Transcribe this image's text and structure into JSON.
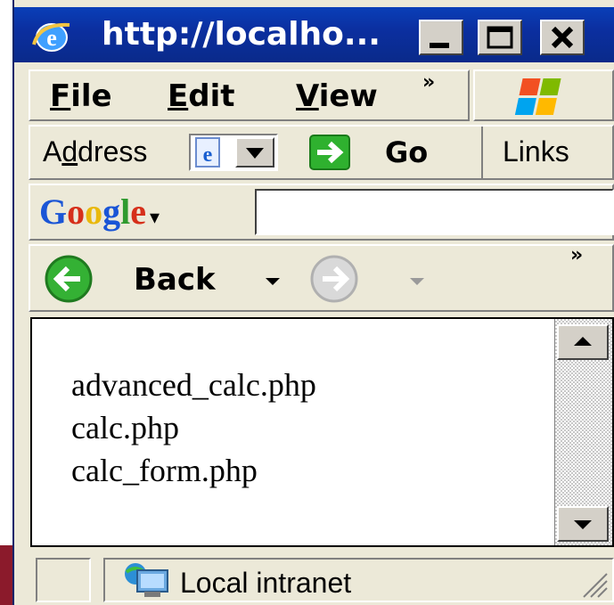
{
  "window": {
    "title": "http://localho..."
  },
  "title_buttons": {
    "minimize": "_",
    "maximize": "□",
    "close": "X"
  },
  "menu": {
    "items": [
      {
        "accel": "F",
        "rest": "ile"
      },
      {
        "accel": "E",
        "rest": "dit"
      },
      {
        "accel": "V",
        "rest": "iew"
      }
    ],
    "overflow": "»"
  },
  "address_bar": {
    "label_pre": "A",
    "label_accel": "d",
    "label_post": "dress",
    "go_label": "Go",
    "links_label": "Links"
  },
  "google_bar": {
    "logo": "Google",
    "dropdown": "▾",
    "search_value": ""
  },
  "nav": {
    "back_label": "Back",
    "overflow": "»"
  },
  "content": {
    "files": [
      "advanced_calc.php",
      "calc.php",
      "calc_form.php"
    ]
  },
  "status_bar": {
    "zone": "Local intranet"
  },
  "colors": {
    "titlebar": "#0a3fb8",
    "chrome": "#ece9d8",
    "frame_accent": "#8b1a2b"
  }
}
